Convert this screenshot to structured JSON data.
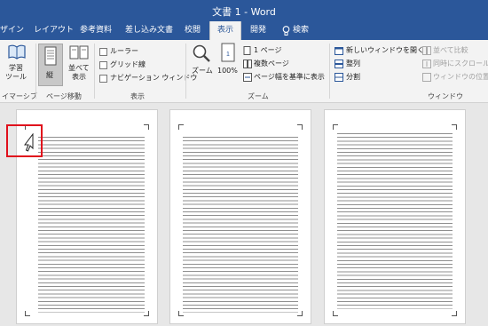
{
  "window": {
    "title": "文書 1 - Word"
  },
  "tabs": [
    {
      "label": "ザイン"
    },
    {
      "label": "レイアウト"
    },
    {
      "label": "参考資料"
    },
    {
      "label": "差し込み文書"
    },
    {
      "label": "校閲"
    },
    {
      "label": "表示",
      "active": true
    },
    {
      "label": "開発"
    },
    {
      "label": "検索"
    }
  ],
  "ribbon": {
    "immersive": {
      "learning_tools_line1": "学習",
      "learning_tools_line2": "ツール",
      "group": "イマーシブ"
    },
    "page_movement": {
      "vertical": "縦",
      "side_by_side_line1": "並べて",
      "side_by_side_line2": "表示",
      "group": "ページ移動"
    },
    "show": {
      "ruler": "ルーラー",
      "gridlines": "グリッド線",
      "navigation_pane": "ナビゲーション ウィンドウ",
      "group": "表示"
    },
    "zoom": {
      "zoom": "ズーム",
      "percent": "100%",
      "one_page": "1 ページ",
      "multiple_pages": "複数ページ",
      "page_width": "ページ幅を基準に表示",
      "group": "ズーム"
    },
    "window": {
      "new_window": "新しいウィンドウを開く",
      "arrange_all": "整列",
      "split": "分割",
      "side_by_side": "並べて比較",
      "sync_scroll": "同時にスクロール",
      "reset_position": "ウィンドウの位置を",
      "group": "ウィンドウ"
    }
  },
  "colors": {
    "title_bar": "#2b579a",
    "ribbon": "#f3f3f3",
    "workspace": "#e7e7e7",
    "highlight": "#e0101c"
  }
}
